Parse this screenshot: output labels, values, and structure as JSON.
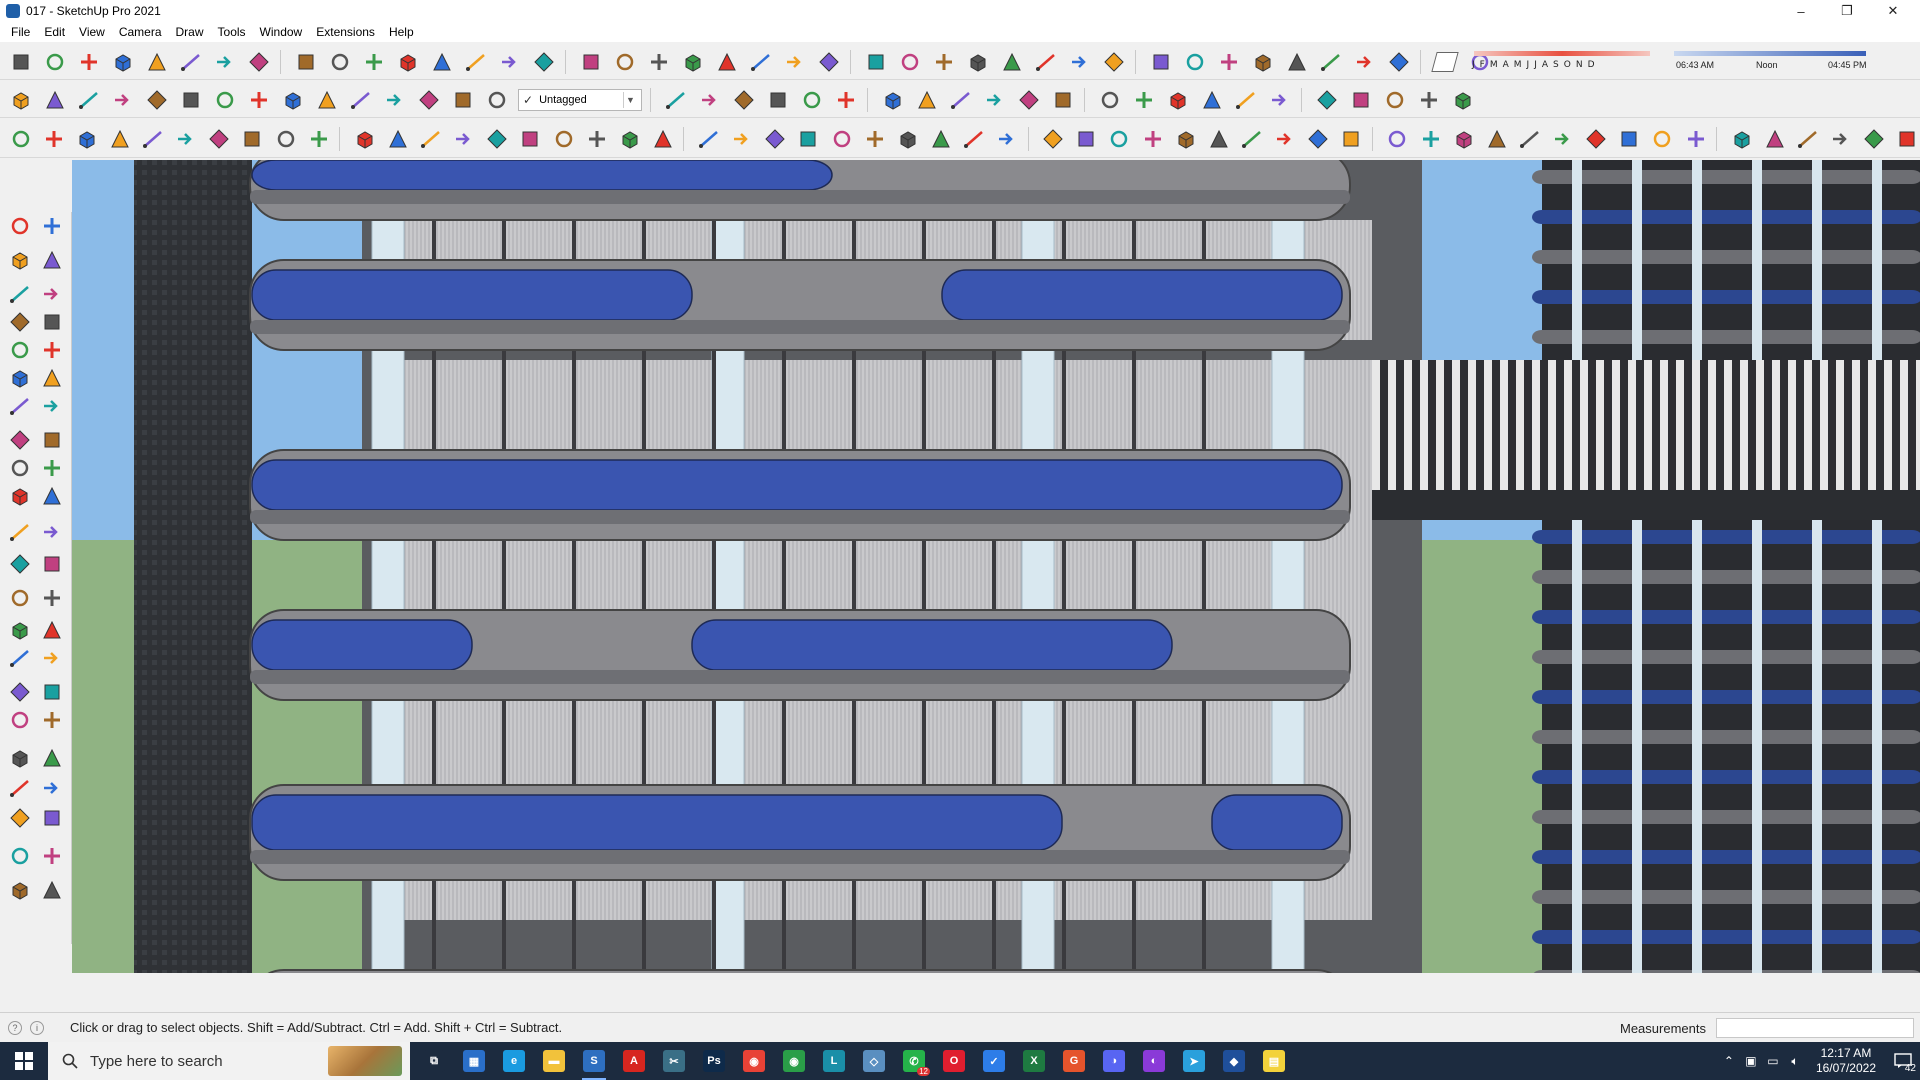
{
  "window": {
    "title": "017 - SketchUp Pro 2021",
    "controls": [
      "–",
      "❐",
      "✕"
    ]
  },
  "menu": [
    "File",
    "Edit",
    "View",
    "Camera",
    "Draw",
    "Tools",
    "Window",
    "Extensions",
    "Help"
  ],
  "tags": {
    "selected": "Untagged"
  },
  "shadows": {
    "months": [
      "J",
      "F",
      "M",
      "A",
      "M",
      "J",
      "J",
      "A",
      "S",
      "O",
      "N",
      "D"
    ],
    "time_start": "06:43 AM",
    "time_mid": "Noon",
    "time_end": "04:45 PM"
  },
  "status": {
    "hint": "Click or drag to select objects. Shift = Add/Subtract. Ctrl = Add. Shift + Ctrl = Subtract.",
    "measurements_label": "Measurements",
    "measurements_value": ""
  },
  "taskbar": {
    "search_placeholder": "Type here to search",
    "time": "12:17 AM",
    "date": "16/07/2022",
    "notifications": "42",
    "apps": [
      {
        "name": "task-view",
        "color": "#1c2b3f",
        "glyph": "⧉"
      },
      {
        "name": "calculator",
        "color": "#2a6fc9",
        "glyph": "▦"
      },
      {
        "name": "edge",
        "color": "#1a9be0",
        "glyph": "e"
      },
      {
        "name": "file-explorer",
        "color": "#f2c23b",
        "glyph": "▬"
      },
      {
        "name": "sketchup",
        "color": "#2e6fc0",
        "glyph": "S"
      },
      {
        "name": "acrobat",
        "color": "#d7261f",
        "glyph": "A"
      },
      {
        "name": "snipping",
        "color": "#3a6f86",
        "glyph": "✂"
      },
      {
        "name": "photoshop",
        "color": "#0e2a4a",
        "glyph": "Ps"
      },
      {
        "name": "chrome",
        "color": "#e84236",
        "glyph": "◉"
      },
      {
        "name": "chrome-2",
        "color": "#2a9e48",
        "glyph": "◉"
      },
      {
        "name": "layout",
        "color": "#1a8fa8",
        "glyph": "L"
      },
      {
        "name": "style-builder",
        "color": "#5a8fc0",
        "glyph": "◇"
      },
      {
        "name": "whatsapp",
        "color": "#25b34a",
        "glyph": "✆"
      },
      {
        "name": "opera",
        "color": "#e01e2f",
        "glyph": "O"
      },
      {
        "name": "todo",
        "color": "#2d7de8",
        "glyph": "✓"
      },
      {
        "name": "excel",
        "color": "#1e7a41",
        "glyph": "X"
      },
      {
        "name": "grammarly",
        "color": "#e5542c",
        "glyph": "G"
      },
      {
        "name": "discord",
        "color": "#5865f2",
        "glyph": "◑"
      },
      {
        "name": "podcasts",
        "color": "#8a3ad8",
        "glyph": "◐"
      },
      {
        "name": "telegram",
        "color": "#2aa0dc",
        "glyph": "➤"
      },
      {
        "name": "app-blue",
        "color": "#1f4f9a",
        "glyph": "◆"
      },
      {
        "name": "sticky-notes",
        "color": "#f3d23b",
        "glyph": "▤"
      }
    ],
    "whatsapp_badge": "12"
  },
  "colors": {
    "sky": "#8bbbe8",
    "ground": "#90b383",
    "slab_blue": "#3a55b0",
    "slab_gray": "#8a8a8e",
    "glass": "#c8c8cc",
    "column": "#d9e8f0",
    "dark_tower": "#3a3d42"
  }
}
